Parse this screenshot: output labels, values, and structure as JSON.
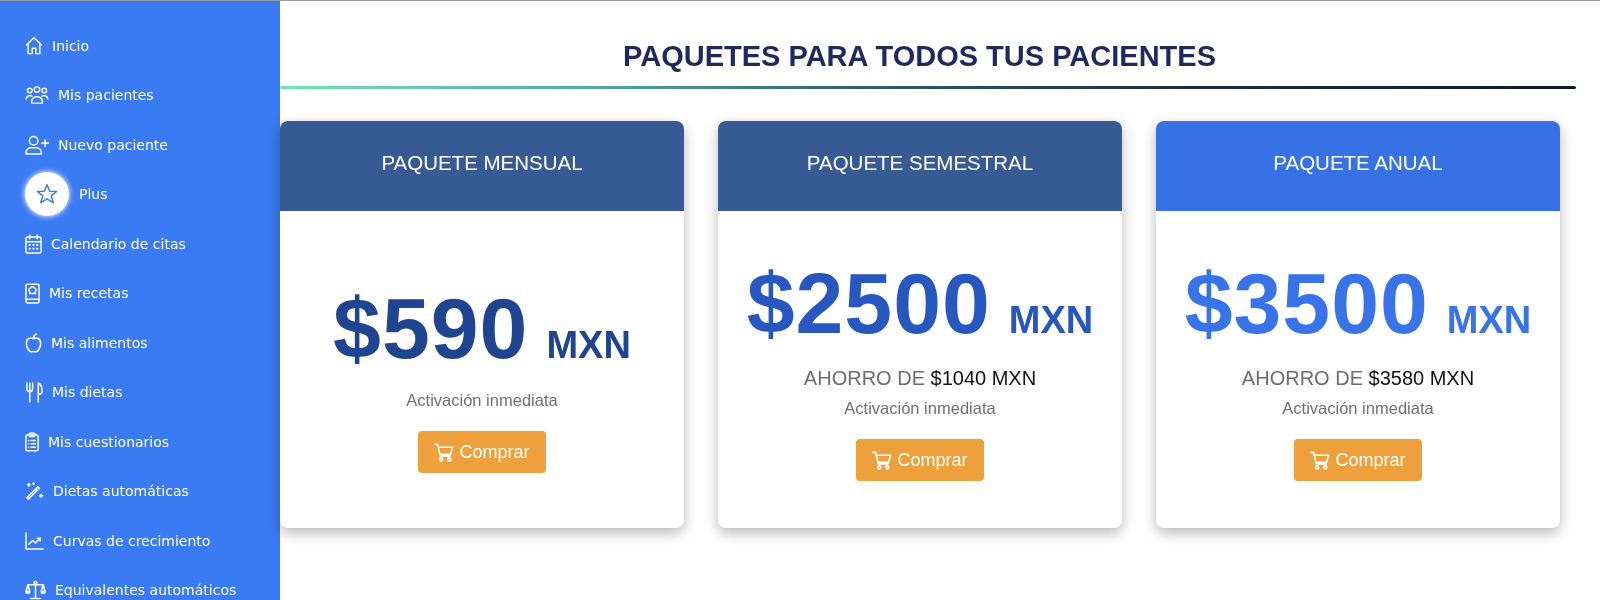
{
  "sidebar": {
    "items": [
      {
        "label": "Inicio",
        "selected": false
      },
      {
        "label": "Mis pacientes",
        "selected": false
      },
      {
        "label": "Nuevo paciente",
        "selected": false
      },
      {
        "label": "Plus",
        "selected": true
      },
      {
        "label": "Calendario de citas",
        "selected": false
      },
      {
        "label": "Mis recetas",
        "selected": false
      },
      {
        "label": "Mis alimentos",
        "selected": false
      },
      {
        "label": "Mis dietas",
        "selected": false
      },
      {
        "label": "Mis cuestionarios",
        "selected": false
      },
      {
        "label": "Dietas automáticas",
        "selected": false
      },
      {
        "label": "Curvas de crecimiento",
        "selected": false
      },
      {
        "label": "Equivalentes automáticos",
        "selected": false
      }
    ]
  },
  "page": {
    "title": "PAQUETES PARA TODOS TUS PACIENTES"
  },
  "plans": [
    {
      "name": "PAQUETE MENSUAL",
      "featured": false,
      "color": "#1f4490",
      "price": "$590",
      "currency": "MXN",
      "activation": "Activación inmediata",
      "button": "Comprar"
    },
    {
      "name": "PAQUETE SEMESTRAL",
      "featured": false,
      "color": "#2857bf",
      "price": "$2500",
      "currency": "MXN",
      "savings": "AHORRO DE **$1040 MXN**",
      "activation": "Activación inmediata",
      "button": "Comprar"
    },
    {
      "name": "PAQUETE ANUAL",
      "featured": true,
      "color": "#3873e8",
      "price": "$3500",
      "currency": "MXN",
      "savings": "AHORRO DE **$3580 MXN**",
      "activation": "Activación inmediata",
      "button": "Comprar"
    }
  ]
}
